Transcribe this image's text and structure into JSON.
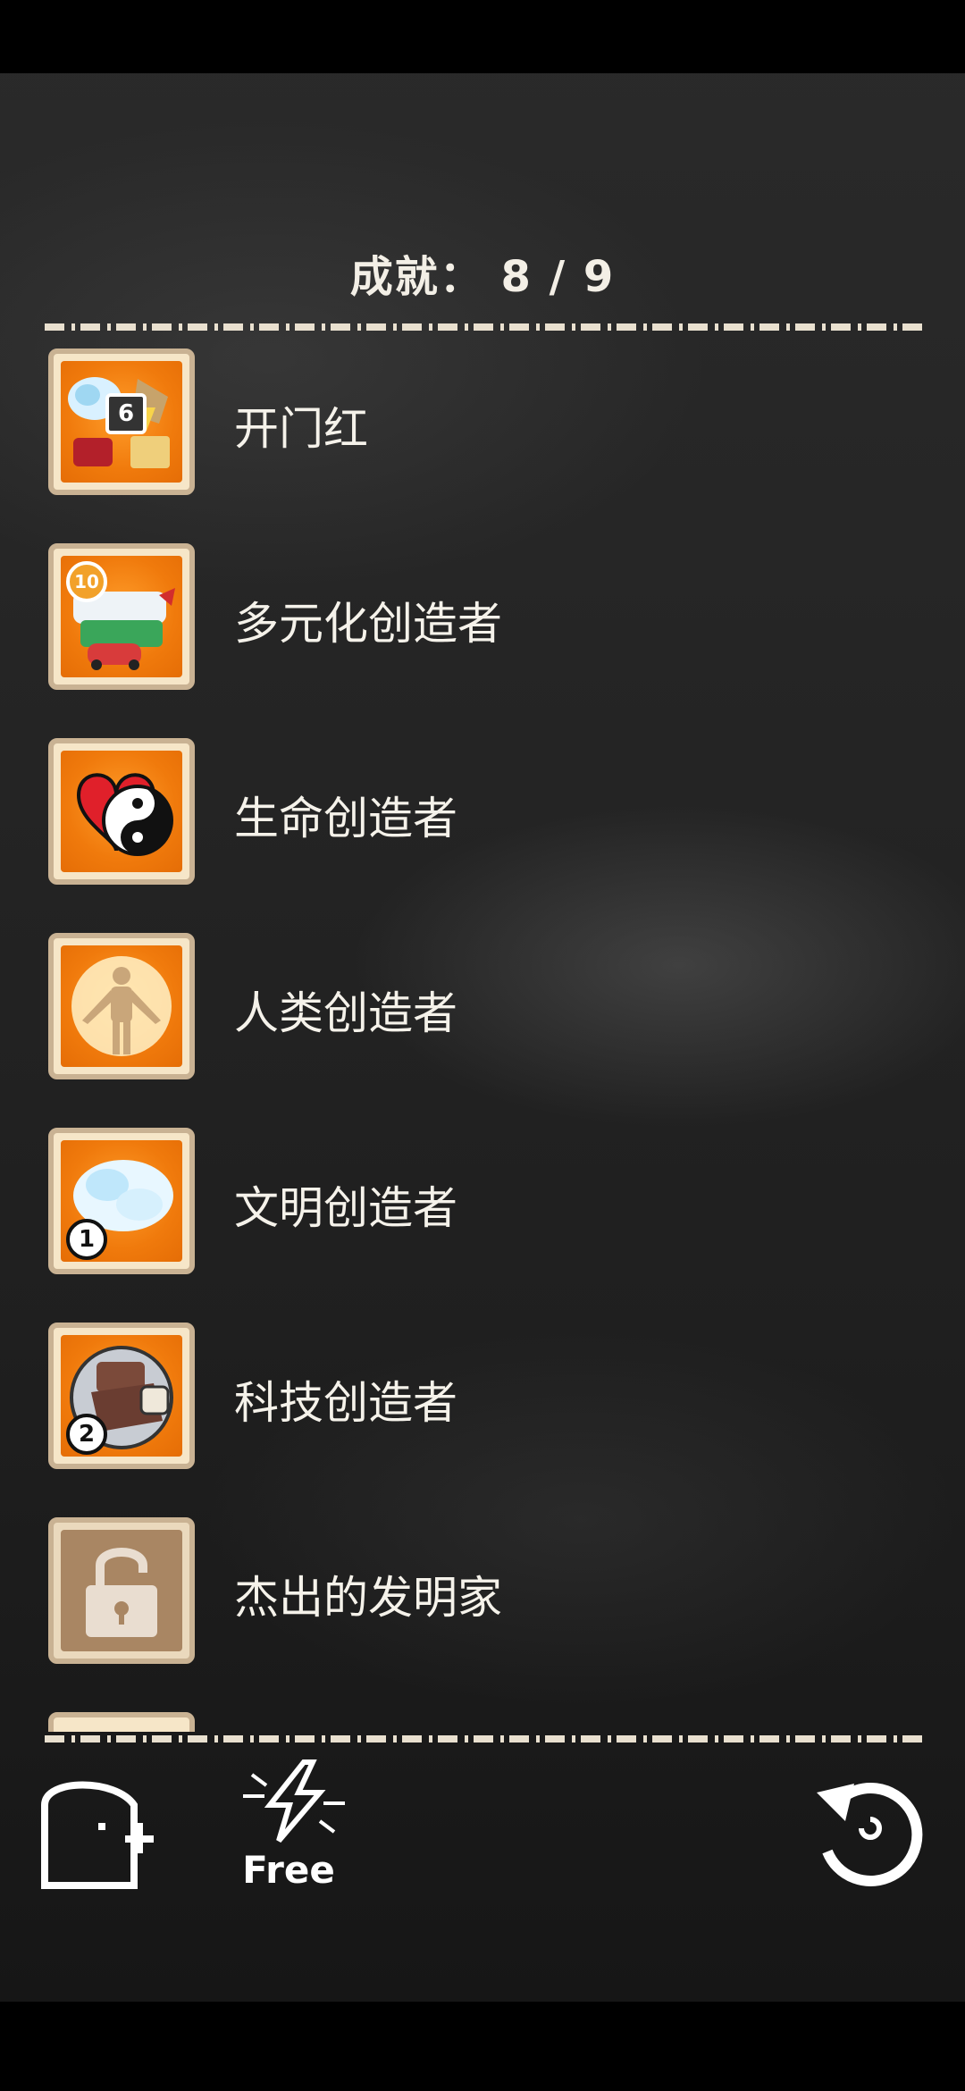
{
  "header": {
    "title": "成就： 8 / 9"
  },
  "achievements": [
    {
      "label": "开门红",
      "icon": "resources-icon",
      "count": "6"
    },
    {
      "label": "多元化创造者",
      "icon": "vehicles-icon",
      "count": "10"
    },
    {
      "label": "生命创造者",
      "icon": "heart-yinyang-icon"
    },
    {
      "label": "人类创造者",
      "icon": "human-figure-icon"
    },
    {
      "label": "文明创造者",
      "icon": "cloud-icon",
      "count": "1"
    },
    {
      "label": "科技创造者",
      "icon": "tech-device-icon",
      "count": "2"
    },
    {
      "label": "杰出的发明家",
      "icon": "padlock-icon"
    }
  ],
  "bottom_bar": {
    "free_label": "Free"
  },
  "colors": {
    "badge_orange": "#f07a0c",
    "badge_border": "#c9b293",
    "text": "#f5f2ea"
  }
}
